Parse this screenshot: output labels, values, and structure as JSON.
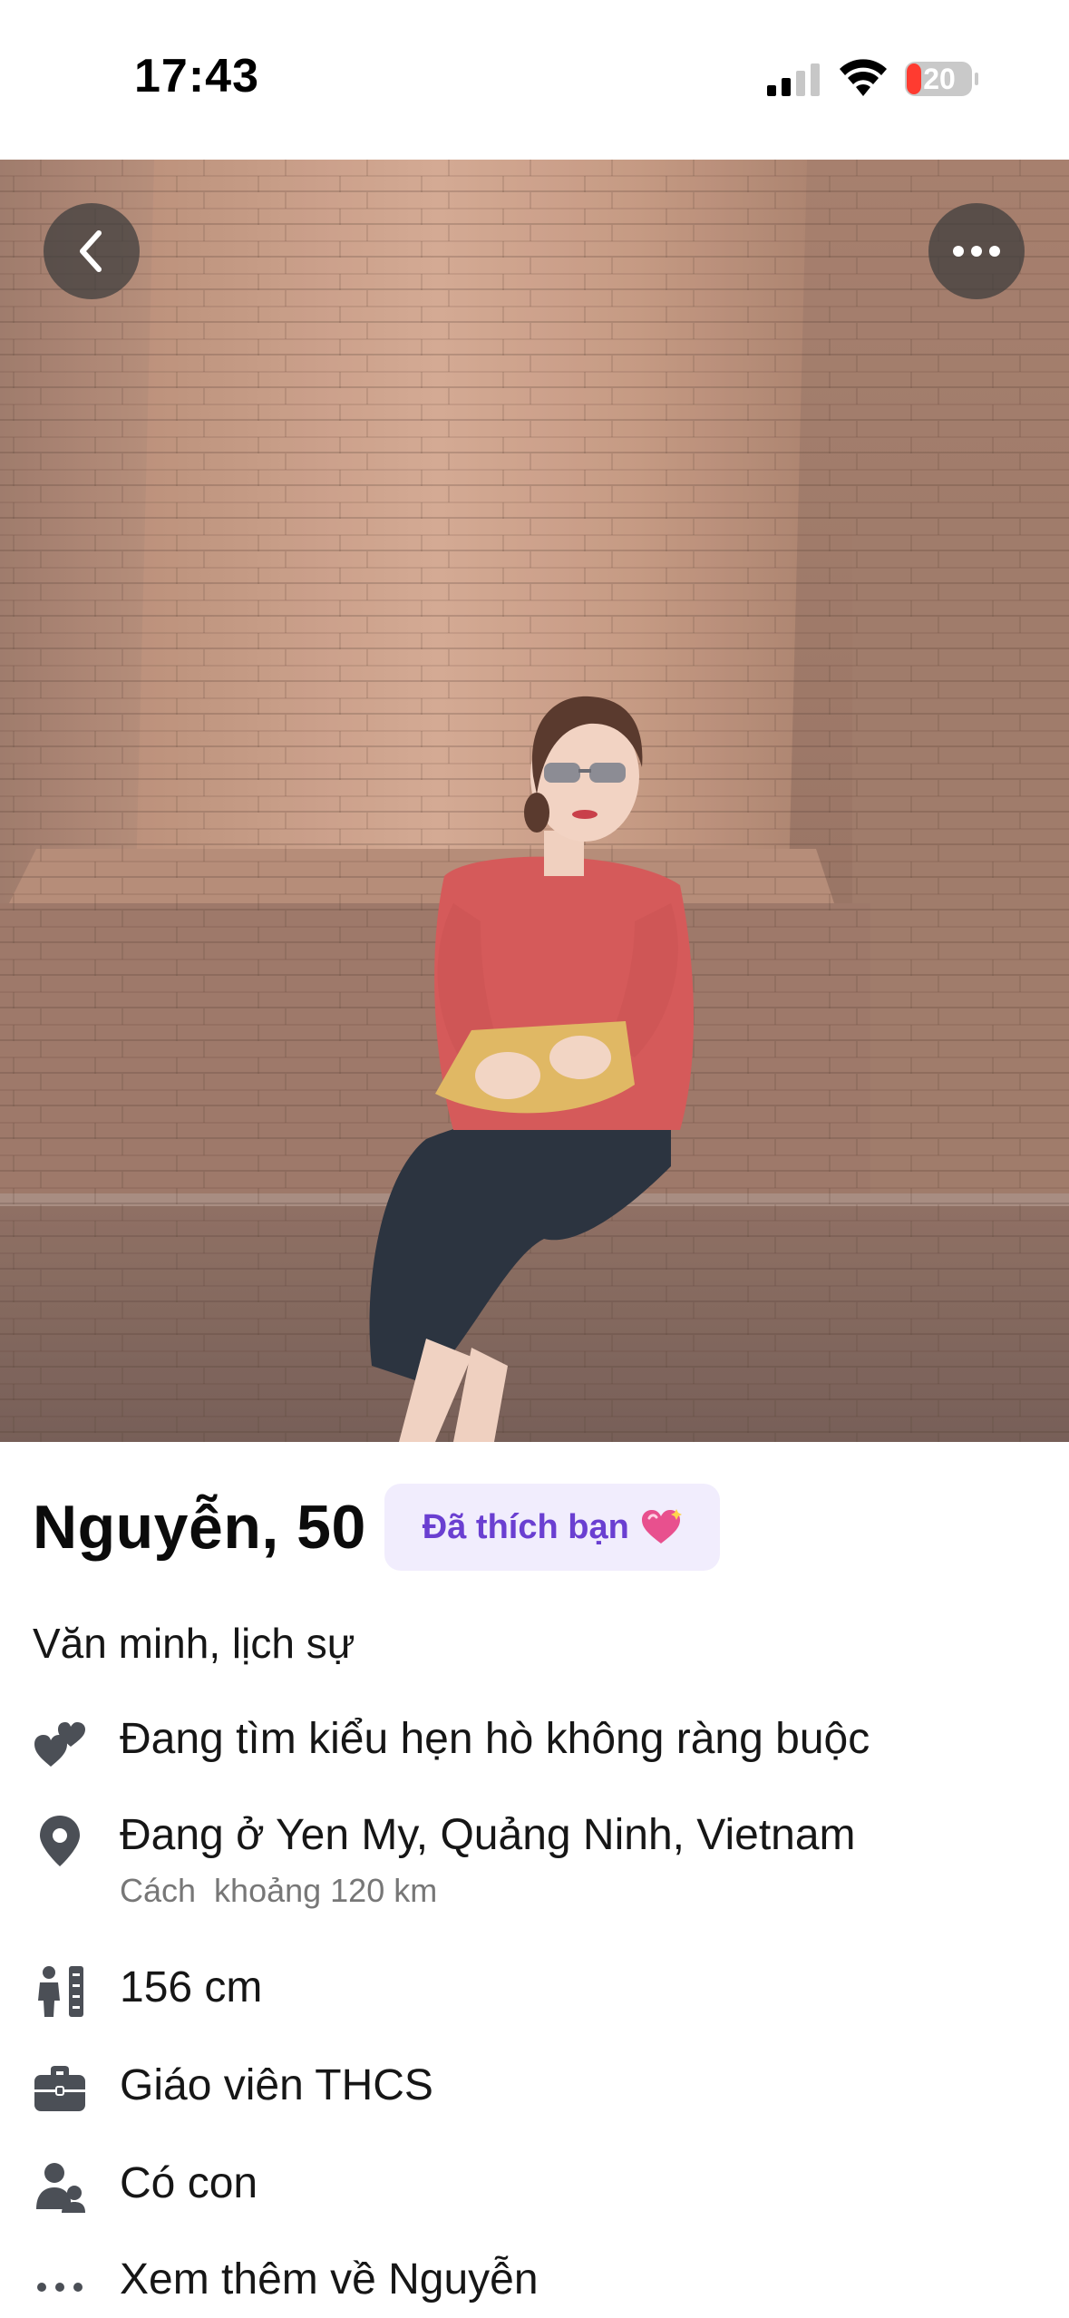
{
  "status_bar": {
    "time": "17:43",
    "battery": "20",
    "icons": [
      "cellular-signal-icon",
      "wifi-icon",
      "battery-low-icon"
    ]
  },
  "photo": {
    "buttons": [
      "back-icon",
      "more-options-icon"
    ]
  },
  "profile": {
    "name_age": "Nguyễn, 50",
    "liked_badge": "Đã thích bạn",
    "bio": "Văn minh, lịch sự",
    "details": {
      "intent": "Đang tìm kiểu hẹn hò không ràng buộc",
      "location": "Đang ở Yen My, Quảng Ninh, Vietnam",
      "distance": "Cách  khoảng 120 km",
      "height": "156 cm",
      "job": "Giáo viên THCS",
      "children": "Có con",
      "see_more": "Xem thêm về Nguyễn"
    }
  },
  "colors": {
    "accent_purple": "#6a3fd1",
    "badge_bg": "#f1edfd",
    "icon_gray": "#4b4f56",
    "battery_red": "#ff3b30"
  }
}
